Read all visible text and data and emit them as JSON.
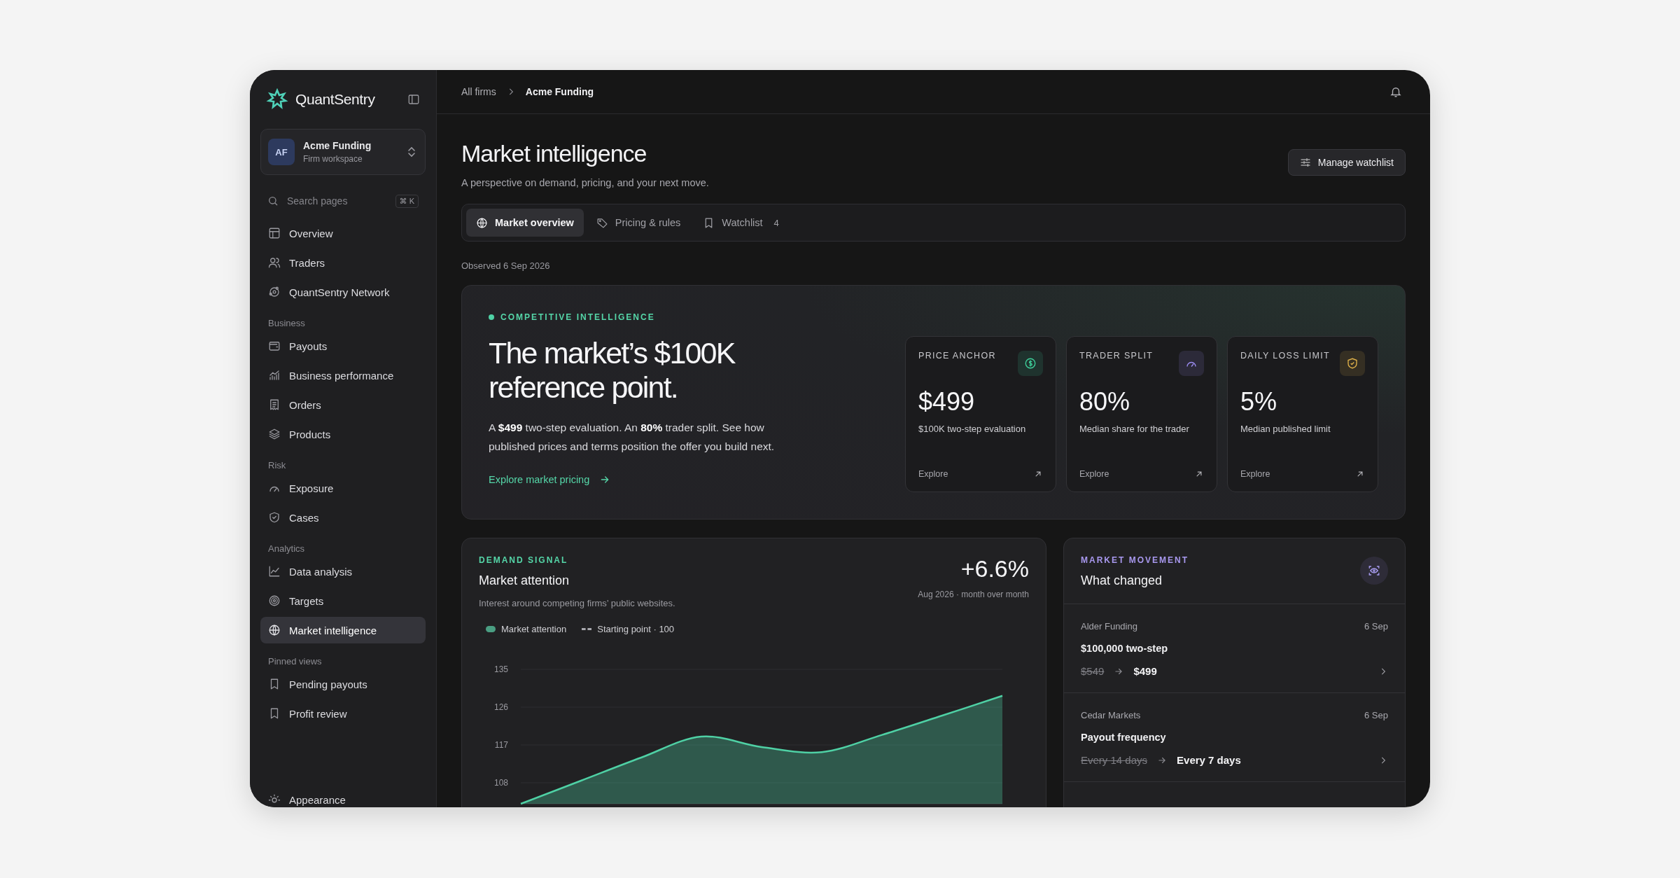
{
  "sidebar": {
    "brand": "QuantSentry",
    "workspace": {
      "initials": "AF",
      "name": "Acme Funding",
      "subtitle": "Firm workspace"
    },
    "search": {
      "placeholder": "Search pages",
      "shortcut": "⌘ K"
    },
    "sections": [
      {
        "items": [
          {
            "label": "Overview",
            "selected": false
          },
          {
            "label": "Traders",
            "selected": false
          },
          {
            "label": "QuantSentry Network",
            "selected": false
          }
        ]
      },
      {
        "label": "Business",
        "items": [
          {
            "label": "Payouts",
            "selected": false
          },
          {
            "label": "Business performance",
            "selected": false
          },
          {
            "label": "Orders",
            "selected": false
          },
          {
            "label": "Products",
            "selected": false
          }
        ]
      },
      {
        "label": "Risk",
        "items": [
          {
            "label": "Exposure",
            "selected": false
          },
          {
            "label": "Cases",
            "selected": false
          }
        ]
      },
      {
        "label": "Analytics",
        "items": [
          {
            "label": "Data analysis",
            "selected": false
          },
          {
            "label": "Targets",
            "selected": false
          },
          {
            "label": "Market intelligence",
            "selected": true
          }
        ]
      },
      {
        "label": "Pinned views",
        "items": [
          {
            "label": "Pending payouts",
            "selected": false
          },
          {
            "label": "Profit review",
            "selected": false
          }
        ]
      }
    ],
    "footer_item": "Appearance"
  },
  "breadcrumb": [
    "All firms",
    "Acme Funding"
  ],
  "page": {
    "title": "Market intelligence",
    "subtitle": "A perspective on demand, pricing, and your next move.",
    "action": "Manage watchlist"
  },
  "tabs": [
    {
      "label": "Market overview",
      "selected": true
    },
    {
      "label": "Pricing & rules",
      "selected": false
    },
    {
      "label": "Watchlist",
      "count": "4",
      "selected": false
    }
  ],
  "observed": "Observed 6 Sep 2026",
  "hero": {
    "eyebrow": "COMPETITIVE INTELLIGENCE",
    "headline": "The market’s $100K reference point.",
    "body": "A **$499** two-step evaluation. An **80%** trader split. See how published prices and terms position the offer you build next.",
    "link": "Explore market pricing",
    "stats": [
      {
        "label": "PRICE ANCHOR",
        "value": "$499",
        "caption": "$100K two-step evaluation",
        "link": "Explore",
        "color": "#3ecf9a"
      },
      {
        "label": "TRADER SPLIT",
        "value": "80%",
        "caption": "Median share for the trader",
        "link": "Explore",
        "color": "#9b8cf0"
      },
      {
        "label": "DAILY LOSS LIMIT",
        "value": "5%",
        "caption": "Median published limit",
        "link": "Explore",
        "color": "#e0b24a"
      }
    ]
  },
  "demand": {
    "eyebrow": "DEMAND SIGNAL",
    "title": "Market attention",
    "subtitle": "Interest around competing firms’ public websites.",
    "change": "+6.6%",
    "change_caption": "Aug 2026 · month over month",
    "baseline_label": "Starting point · 100",
    "chart_data": {
      "type": "area",
      "grid": true,
      "ylim": [
        103,
        135
      ],
      "yticks": [
        108,
        117,
        126,
        135
      ],
      "series": [
        {
          "name": "Market attention",
          "color": "#4fd1a5",
          "values": [
            103,
            108.5,
            114,
            119,
            116.5,
            115.3,
            119.4,
            124,
            128.7
          ]
        }
      ]
    }
  },
  "movement": {
    "eyebrow": "MARKET MOVEMENT",
    "title": "What changed",
    "items": [
      {
        "firm": "Alder Funding",
        "date": "6 Sep",
        "title": "$100,000 two-step",
        "old": "$549",
        "new": "$499"
      },
      {
        "firm": "Cedar Markets",
        "date": "6 Sep",
        "title": "Payout frequency",
        "old": "Every 14 days",
        "new": "Every 7 days"
      }
    ]
  }
}
